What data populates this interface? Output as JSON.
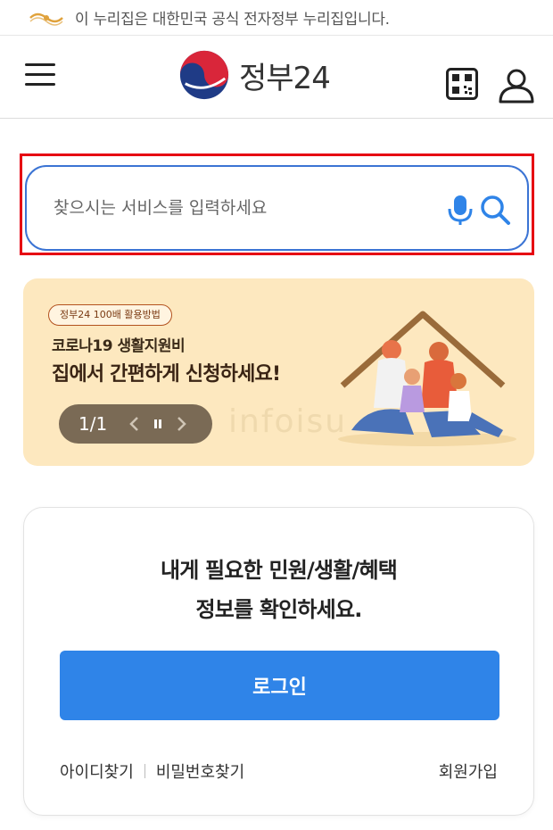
{
  "gov_bar": {
    "notice": "이 누리집은 대한민국 공식 전자정부 누리집입니다."
  },
  "header": {
    "logo_text": "정부24",
    "qr_icon": "qr-code-icon",
    "user_icon": "user-icon",
    "menu_icon": "hamburger-menu-icon"
  },
  "search": {
    "placeholder": "찾으시는 서비스를 입력하세요",
    "value": "",
    "mic_icon": "microphone-icon",
    "search_icon": "search-icon",
    "accent": "#3b74d4",
    "highlight": "#e60012"
  },
  "banner": {
    "tag": "정부24 100배 활용방법",
    "subtitle": "코로나19 생활지원비",
    "title": "집에서 간편하게 신청하세요!",
    "watermark": "infoisu",
    "page_indicator": "1/1",
    "background": "#fde8bf"
  },
  "login_card": {
    "message_line1": "내게 필요한 민원/생활/혜택",
    "message_line2": "정보를 확인하세요.",
    "login_label": "로그인",
    "find_id": "아이디찾기",
    "find_pw": "비밀번호찾기",
    "signup": "회원가입",
    "button_color": "#2f84e8"
  }
}
